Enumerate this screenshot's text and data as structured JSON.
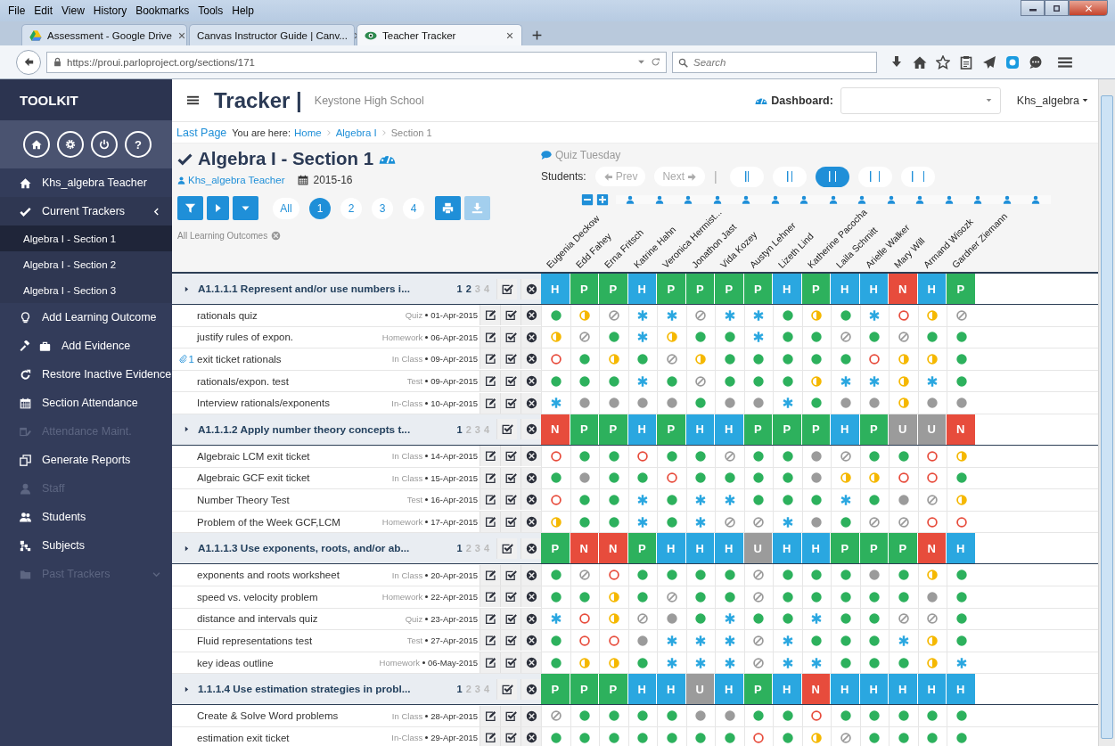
{
  "browser": {
    "menu": [
      "File",
      "Edit",
      "View",
      "History",
      "Bookmarks",
      "Tools",
      "Help"
    ],
    "tabs": [
      {
        "title": "Assessment - Google Drive",
        "selected": false
      },
      {
        "title": "Canvas Instructor Guide | Canv...",
        "selected": false
      },
      {
        "title": "Teacher Tracker",
        "selected": true
      }
    ],
    "url": "https://proui.parloproject.org/sections/171",
    "search_placeholder": "Search"
  },
  "sidebar": {
    "title": "TOOLKIT",
    "help_label": "?",
    "items": [
      {
        "label": "Khs_algebra Teacher",
        "kind": "link",
        "disabled": false
      },
      {
        "label": "Current Trackers",
        "kind": "group",
        "disabled": false,
        "expanded": true,
        "children": [
          {
            "label": "Algebra I - Section 1",
            "selected": true
          },
          {
            "label": "Algebra I - Section 2",
            "selected": false
          },
          {
            "label": "Algebra I - Section 3",
            "selected": false
          }
        ]
      },
      {
        "label": "Add Learning Outcome",
        "kind": "link",
        "disabled": false
      },
      {
        "label": "Add Evidence",
        "kind": "link",
        "disabled": false
      },
      {
        "label": "Restore Inactive Evidence",
        "kind": "link",
        "disabled": false
      },
      {
        "label": "Section Attendance",
        "kind": "link",
        "disabled": false
      },
      {
        "label": "Attendance Maint.",
        "kind": "link",
        "disabled": true
      },
      {
        "label": "Generate Reports",
        "kind": "link",
        "disabled": false
      },
      {
        "label": "Staff",
        "kind": "link",
        "disabled": true
      },
      {
        "label": "Students",
        "kind": "link",
        "disabled": false
      },
      {
        "label": "Subjects",
        "kind": "link",
        "disabled": false
      },
      {
        "label": "Past Trackers",
        "kind": "group",
        "disabled": true,
        "expanded": false
      }
    ]
  },
  "header": {
    "title": "Tracker |",
    "school": "Keystone High School",
    "dashboard_label": "Dashboard:",
    "user": "Khs_algebra"
  },
  "breadcrumb": {
    "back": "Last Page",
    "prefix": "You are here:",
    "trail": [
      {
        "label": "Home",
        "link": true
      },
      {
        "label": "Algebra I",
        "link": true
      },
      {
        "label": "Section 1",
        "link": false
      }
    ]
  },
  "section": {
    "title": "Algebra I - Section 1",
    "teacher": "Khs_algebra Teacher",
    "year": "2015-16",
    "views": [
      {
        "label": "All",
        "selected": false
      },
      {
        "label": "1",
        "selected": true
      },
      {
        "label": "2",
        "selected": false
      },
      {
        "label": "3",
        "selected": false
      },
      {
        "label": "4",
        "selected": false
      }
    ],
    "download_disabled": true,
    "filter_label": "All Learning Outcomes"
  },
  "students_panel": {
    "note": "Quiz Tuesday",
    "label": "Students:",
    "prev": "Prev",
    "next": "Next",
    "separator": "|",
    "widths": [
      {
        "selected": false
      },
      {
        "selected": false
      },
      {
        "selected": true
      },
      {
        "selected": false
      },
      {
        "selected": false
      }
    ]
  },
  "students": [
    "Eugenia Deckow",
    "Edd Fahey",
    "Erna Fritsch",
    "Katrine Hahn",
    "Veronica Hermist...",
    "Jonathon Jast",
    "Vida Kozey",
    "Austyn Lehner",
    "Lizeth Lind",
    "Katherine Pacocha",
    "Laila Schmitt",
    "Arielle Walker",
    "Mary Will",
    "Armand Wisozk",
    "Gardner Ziemann"
  ],
  "outcomes": [
    {
      "title": "A1.1.1.1 Represent and/or use numbers i...",
      "levels": [
        {
          "label": "1",
          "selected": true
        },
        {
          "label": "2",
          "selected": true
        },
        {
          "label": "3",
          "selected": false
        },
        {
          "label": "4",
          "selected": false
        }
      ],
      "scores": [
        {
          "label": "H",
          "color": "#2aa7e0"
        },
        {
          "label": "P",
          "color": "#2db15d"
        },
        {
          "label": "P",
          "color": "#2db15d"
        },
        {
          "label": "H",
          "color": "#2aa7e0"
        },
        {
          "label": "P",
          "color": "#2db15d"
        },
        {
          "label": "P",
          "color": "#2db15d"
        },
        {
          "label": "P",
          "color": "#2db15d"
        },
        {
          "label": "P",
          "color": "#2db15d"
        },
        {
          "label": "H",
          "color": "#2aa7e0"
        },
        {
          "label": "P",
          "color": "#2db15d"
        },
        {
          "label": "H",
          "color": "#2aa7e0"
        },
        {
          "label": "H",
          "color": "#2aa7e0"
        },
        {
          "label": "N",
          "color": "#e74c3c"
        },
        {
          "label": "H",
          "color": "#2aa7e0"
        },
        {
          "label": "P",
          "color": "#2db15d"
        }
      ],
      "items": [
        {
          "title": "rationals quiz",
          "type": "Quiz",
          "date": "01-Apr-2015",
          "marks": [
            {
              "kind": "full"
            },
            {
              "kind": "half"
            },
            {
              "kind": "slash"
            },
            {
              "kind": "star"
            },
            {
              "kind": "star"
            },
            {
              "kind": "slash"
            },
            {
              "kind": "star"
            },
            {
              "kind": "star"
            },
            {
              "kind": "full"
            },
            {
              "kind": "half"
            },
            {
              "kind": "full"
            },
            {
              "kind": "star"
            },
            {
              "kind": "ring"
            },
            {
              "kind": "half"
            },
            {
              "kind": "slash"
            }
          ]
        },
        {
          "title": "justify rules of expon.",
          "type": "Homework",
          "date": "06-Apr-2015",
          "marks": [
            {
              "kind": "half"
            },
            {
              "kind": "slash"
            },
            {
              "kind": "full"
            },
            {
              "kind": "star"
            },
            {
              "kind": "half"
            },
            {
              "kind": "full"
            },
            {
              "kind": "full"
            },
            {
              "kind": "star"
            },
            {
              "kind": "full"
            },
            {
              "kind": "full"
            },
            {
              "kind": "slash"
            },
            {
              "kind": "full"
            },
            {
              "kind": "slash"
            },
            {
              "kind": "full"
            },
            {
              "kind": "full"
            }
          ]
        },
        {
          "title": "exit ticket rationals",
          "attachments": "1",
          "type": "In Class",
          "date": "09-Apr-2015",
          "marks": [
            {
              "kind": "ring"
            },
            {
              "kind": "full"
            },
            {
              "kind": "half"
            },
            {
              "kind": "full"
            },
            {
              "kind": "slash"
            },
            {
              "kind": "half"
            },
            {
              "kind": "full"
            },
            {
              "kind": "full"
            },
            {
              "kind": "full"
            },
            {
              "kind": "full"
            },
            {
              "kind": "full"
            },
            {
              "kind": "ring"
            },
            {
              "kind": "half"
            },
            {
              "kind": "half"
            },
            {
              "kind": "full"
            }
          ]
        },
        {
          "title": "rationals/expon. test",
          "type": "Test",
          "date": "09-Apr-2015",
          "marks": [
            {
              "kind": "full"
            },
            {
              "kind": "full"
            },
            {
              "kind": "full"
            },
            {
              "kind": "star"
            },
            {
              "kind": "full"
            },
            {
              "kind": "slash"
            },
            {
              "kind": "full"
            },
            {
              "kind": "full"
            },
            {
              "kind": "full"
            },
            {
              "kind": "half"
            },
            {
              "kind": "star"
            },
            {
              "kind": "star"
            },
            {
              "kind": "half"
            },
            {
              "kind": "star"
            },
            {
              "kind": "full"
            }
          ]
        },
        {
          "title": "Interview rationals/exponents",
          "type": "In-Class",
          "date": "10-Apr-2015",
          "marks": [
            {
              "kind": "star"
            },
            {
              "kind": "grey"
            },
            {
              "kind": "grey"
            },
            {
              "kind": "grey"
            },
            {
              "kind": "grey"
            },
            {
              "kind": "full"
            },
            {
              "kind": "grey"
            },
            {
              "kind": "grey"
            },
            {
              "kind": "star"
            },
            {
              "kind": "full"
            },
            {
              "kind": "grey"
            },
            {
              "kind": "grey"
            },
            {
              "kind": "half"
            },
            {
              "kind": "grey"
            },
            {
              "kind": "grey"
            }
          ]
        }
      ]
    },
    {
      "title": "A1.1.1.2 Apply number theory concepts t...",
      "levels": [
        {
          "label": "1",
          "selected": true
        },
        {
          "label": "2",
          "selected": false
        },
        {
          "label": "3",
          "selected": false
        },
        {
          "label": "4",
          "selected": false
        }
      ],
      "scores": [
        {
          "label": "N",
          "color": "#e74c3c"
        },
        {
          "label": "P",
          "color": "#2db15d"
        },
        {
          "label": "P",
          "color": "#2db15d"
        },
        {
          "label": "H",
          "color": "#2aa7e0"
        },
        {
          "label": "P",
          "color": "#2db15d"
        },
        {
          "label": "H",
          "color": "#2aa7e0"
        },
        {
          "label": "H",
          "color": "#2aa7e0"
        },
        {
          "label": "P",
          "color": "#2db15d"
        },
        {
          "label": "P",
          "color": "#2db15d"
        },
        {
          "label": "P",
          "color": "#2db15d"
        },
        {
          "label": "H",
          "color": "#2aa7e0"
        },
        {
          "label": "P",
          "color": "#2db15d"
        },
        {
          "label": "U",
          "color": "#9b9b9b"
        },
        {
          "label": "U",
          "color": "#9b9b9b"
        },
        {
          "label": "N",
          "color": "#e74c3c"
        }
      ],
      "items": [
        {
          "title": "Algebraic LCM exit ticket",
          "type": "In Class",
          "date": "14-Apr-2015",
          "marks": [
            {
              "kind": "ring"
            },
            {
              "kind": "full"
            },
            {
              "kind": "full"
            },
            {
              "kind": "ring"
            },
            {
              "kind": "full"
            },
            {
              "kind": "full"
            },
            {
              "kind": "slash"
            },
            {
              "kind": "full"
            },
            {
              "kind": "full"
            },
            {
              "kind": "grey"
            },
            {
              "kind": "slash"
            },
            {
              "kind": "full"
            },
            {
              "kind": "full"
            },
            {
              "kind": "ring"
            },
            {
              "kind": "half"
            }
          ]
        },
        {
          "title": "Algebraic GCF exit ticket",
          "type": "In Class",
          "date": "15-Apr-2015",
          "marks": [
            {
              "kind": "full"
            },
            {
              "kind": "grey"
            },
            {
              "kind": "full"
            },
            {
              "kind": "full"
            },
            {
              "kind": "ring"
            },
            {
              "kind": "full"
            },
            {
              "kind": "full"
            },
            {
              "kind": "full"
            },
            {
              "kind": "full"
            },
            {
              "kind": "grey"
            },
            {
              "kind": "half"
            },
            {
              "kind": "half"
            },
            {
              "kind": "ring"
            },
            {
              "kind": "ring"
            },
            {
              "kind": "full"
            }
          ]
        },
        {
          "title": "Number Theory Test",
          "type": "Test",
          "date": "16-Apr-2015",
          "marks": [
            {
              "kind": "ring"
            },
            {
              "kind": "full"
            },
            {
              "kind": "full"
            },
            {
              "kind": "star"
            },
            {
              "kind": "full"
            },
            {
              "kind": "star"
            },
            {
              "kind": "star"
            },
            {
              "kind": "full"
            },
            {
              "kind": "full"
            },
            {
              "kind": "full"
            },
            {
              "kind": "star"
            },
            {
              "kind": "full"
            },
            {
              "kind": "grey"
            },
            {
              "kind": "slash"
            },
            {
              "kind": "half"
            }
          ]
        },
        {
          "title": "Problem of the Week GCF,LCM",
          "type": "Homework",
          "date": "17-Apr-2015",
          "marks": [
            {
              "kind": "half"
            },
            {
              "kind": "full"
            },
            {
              "kind": "full"
            },
            {
              "kind": "star"
            },
            {
              "kind": "full"
            },
            {
              "kind": "star"
            },
            {
              "kind": "slash"
            },
            {
              "kind": "slash"
            },
            {
              "kind": "star"
            },
            {
              "kind": "grey"
            },
            {
              "kind": "full"
            },
            {
              "kind": "slash"
            },
            {
              "kind": "slash"
            },
            {
              "kind": "ring"
            },
            {
              "kind": "ring"
            }
          ]
        }
      ]
    },
    {
      "title": "A1.1.1.3 Use exponents, roots, and/or ab...",
      "levels": [
        {
          "label": "1",
          "selected": true
        },
        {
          "label": "2",
          "selected": false
        },
        {
          "label": "3",
          "selected": false
        },
        {
          "label": "4",
          "selected": false
        }
      ],
      "scores": [
        {
          "label": "P",
          "color": "#2db15d"
        },
        {
          "label": "N",
          "color": "#e74c3c"
        },
        {
          "label": "N",
          "color": "#e74c3c"
        },
        {
          "label": "P",
          "color": "#2db15d"
        },
        {
          "label": "H",
          "color": "#2aa7e0"
        },
        {
          "label": "H",
          "color": "#2aa7e0"
        },
        {
          "label": "H",
          "color": "#2aa7e0"
        },
        {
          "label": "U",
          "color": "#9b9b9b"
        },
        {
          "label": "H",
          "color": "#2aa7e0"
        },
        {
          "label": "H",
          "color": "#2aa7e0"
        },
        {
          "label": "P",
          "color": "#2db15d"
        },
        {
          "label": "P",
          "color": "#2db15d"
        },
        {
          "label": "P",
          "color": "#2db15d"
        },
        {
          "label": "N",
          "color": "#e74c3c"
        },
        {
          "label": "H",
          "color": "#2aa7e0"
        }
      ],
      "items": [
        {
          "title": "exponents and roots worksheet",
          "type": "In Class",
          "date": "20-Apr-2015",
          "marks": [
            {
              "kind": "full"
            },
            {
              "kind": "slash"
            },
            {
              "kind": "ring"
            },
            {
              "kind": "full"
            },
            {
              "kind": "full"
            },
            {
              "kind": "full"
            },
            {
              "kind": "full"
            },
            {
              "kind": "slash"
            },
            {
              "kind": "full"
            },
            {
              "kind": "full"
            },
            {
              "kind": "full"
            },
            {
              "kind": "grey"
            },
            {
              "kind": "full"
            },
            {
              "kind": "half"
            },
            {
              "kind": "full"
            }
          ]
        },
        {
          "title": "speed vs. velocity problem",
          "type": "Homework",
          "date": "22-Apr-2015",
          "marks": [
            {
              "kind": "full"
            },
            {
              "kind": "full"
            },
            {
              "kind": "half"
            },
            {
              "kind": "full"
            },
            {
              "kind": "slash"
            },
            {
              "kind": "full"
            },
            {
              "kind": "full"
            },
            {
              "kind": "slash"
            },
            {
              "kind": "full"
            },
            {
              "kind": "full"
            },
            {
              "kind": "full"
            },
            {
              "kind": "full"
            },
            {
              "kind": "full"
            },
            {
              "kind": "grey"
            },
            {
              "kind": "full"
            }
          ]
        },
        {
          "title": "distance and intervals quiz",
          "type": "Quiz",
          "date": "23-Apr-2015",
          "marks": [
            {
              "kind": "star"
            },
            {
              "kind": "ring"
            },
            {
              "kind": "half"
            },
            {
              "kind": "slash"
            },
            {
              "kind": "grey"
            },
            {
              "kind": "full"
            },
            {
              "kind": "star"
            },
            {
              "kind": "full"
            },
            {
              "kind": "full"
            },
            {
              "kind": "star"
            },
            {
              "kind": "full"
            },
            {
              "kind": "full"
            },
            {
              "kind": "slash"
            },
            {
              "kind": "slash"
            },
            {
              "kind": "full"
            }
          ]
        },
        {
          "title": "Fluid representations test",
          "type": "Test",
          "date": "27-Apr-2015",
          "marks": [
            {
              "kind": "full"
            },
            {
              "kind": "ring"
            },
            {
              "kind": "ring"
            },
            {
              "kind": "grey"
            },
            {
              "kind": "star"
            },
            {
              "kind": "star"
            },
            {
              "kind": "star"
            },
            {
              "kind": "slash"
            },
            {
              "kind": "star"
            },
            {
              "kind": "full"
            },
            {
              "kind": "full"
            },
            {
              "kind": "full"
            },
            {
              "kind": "star"
            },
            {
              "kind": "half"
            },
            {
              "kind": "full"
            }
          ]
        },
        {
          "title": "key ideas outline",
          "type": "Homework",
          "date": "06-May-2015",
          "marks": [
            {
              "kind": "full"
            },
            {
              "kind": "half"
            },
            {
              "kind": "half"
            },
            {
              "kind": "full"
            },
            {
              "kind": "star"
            },
            {
              "kind": "star"
            },
            {
              "kind": "star"
            },
            {
              "kind": "slash"
            },
            {
              "kind": "star"
            },
            {
              "kind": "star"
            },
            {
              "kind": "full"
            },
            {
              "kind": "full"
            },
            {
              "kind": "full"
            },
            {
              "kind": "half"
            },
            {
              "kind": "star"
            }
          ]
        }
      ]
    },
    {
      "title": "1.1.1.4 Use estimation strategies in probl...",
      "levels": [
        {
          "label": "1",
          "selected": true
        },
        {
          "label": "2",
          "selected": false
        },
        {
          "label": "3",
          "selected": false
        },
        {
          "label": "4",
          "selected": false
        }
      ],
      "scores": [
        {
          "label": "P",
          "color": "#2db15d"
        },
        {
          "label": "P",
          "color": "#2db15d"
        },
        {
          "label": "P",
          "color": "#2db15d"
        },
        {
          "label": "H",
          "color": "#2aa7e0"
        },
        {
          "label": "H",
          "color": "#2aa7e0"
        },
        {
          "label": "U",
          "color": "#9b9b9b"
        },
        {
          "label": "H",
          "color": "#2aa7e0"
        },
        {
          "label": "P",
          "color": "#2db15d"
        },
        {
          "label": "H",
          "color": "#2aa7e0"
        },
        {
          "label": "N",
          "color": "#e74c3c"
        },
        {
          "label": "H",
          "color": "#2aa7e0"
        },
        {
          "label": "H",
          "color": "#2aa7e0"
        },
        {
          "label": "H",
          "color": "#2aa7e0"
        },
        {
          "label": "H",
          "color": "#2aa7e0"
        },
        {
          "label": "H",
          "color": "#2aa7e0"
        }
      ],
      "items": [
        {
          "title": "Create & Solve Word problems",
          "type": "In Class",
          "date": "28-Apr-2015",
          "marks": [
            {
              "kind": "slash"
            },
            {
              "kind": "full"
            },
            {
              "kind": "full"
            },
            {
              "kind": "full"
            },
            {
              "kind": "full"
            },
            {
              "kind": "grey"
            },
            {
              "kind": "grey"
            },
            {
              "kind": "full"
            },
            {
              "kind": "full"
            },
            {
              "kind": "ring"
            },
            {
              "kind": "full"
            },
            {
              "kind": "full"
            },
            {
              "kind": "full"
            },
            {
              "kind": "full"
            },
            {
              "kind": "full"
            }
          ]
        },
        {
          "title": "estimation exit ticket",
          "type": "In-Class",
          "date": "29-Apr-2015",
          "marks": [
            {
              "kind": "full"
            },
            {
              "kind": "full"
            },
            {
              "kind": "full"
            },
            {
              "kind": "full"
            },
            {
              "kind": "full"
            },
            {
              "kind": "full"
            },
            {
              "kind": "full"
            },
            {
              "kind": "ring"
            },
            {
              "kind": "full"
            },
            {
              "kind": "half"
            },
            {
              "kind": "slash"
            },
            {
              "kind": "full"
            },
            {
              "kind": "full"
            },
            {
              "kind": "full"
            },
            {
              "kind": "full"
            }
          ]
        }
      ]
    }
  ]
}
